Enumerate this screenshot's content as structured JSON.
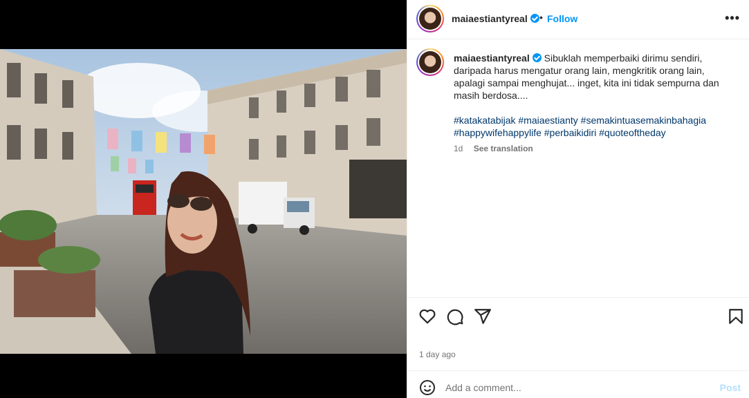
{
  "post": {
    "username": "maiaestiantyreal",
    "verified": true,
    "follow_label": "Follow",
    "dot_separator": "•",
    "more_icon": "more-horizontal-icon",
    "more_label": "•••"
  },
  "caption": {
    "username": "maiaestiantyreal",
    "text": "Sibuklah memperbaiki dirimu sendiri, daripada harus mengatur orang lain, mengkritik orang lain, apalagi sampai menghujat... inget, kita ini tidak sempurna dan masih berdosa....",
    "hashtags": "#katakatabijak #maiaestianty #semakintuasemakinbahagia #happywifehappylife #perbaikidiri #quoteoftheday",
    "time_ago": "1d",
    "see_translation": "See translation"
  },
  "actions": {
    "like_icon": "heart-icon",
    "comment_icon": "comment-icon",
    "share_icon": "send-icon",
    "save_icon": "bookmark-icon"
  },
  "date_label": "1 day ago",
  "comment": {
    "placeholder": "Add a comment...",
    "post_label": "Post",
    "emoji_icon": "emoji-icon"
  },
  "colors": {
    "link_blue": "#0095f6",
    "hashtag_blue": "#00376b",
    "muted": "#737373",
    "post_disabled": "#b2dffc"
  }
}
